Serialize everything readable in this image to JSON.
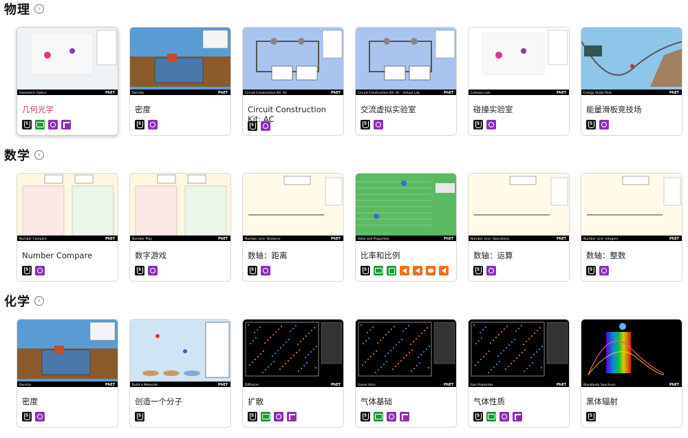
{
  "sections": [
    {
      "title": "物理",
      "cards": [
        {
          "title": "几何光学",
          "active": true,
          "thumb_label": "Geometric Optics",
          "badges": [
            "html5",
            "kbd",
            "zoom",
            "touch"
          ],
          "bg": "#eef3f8"
        },
        {
          "title": "密度",
          "thumb_label": "Density",
          "badges": [
            "html5",
            "zoom"
          ],
          "bg": "#5a9bd4"
        },
        {
          "title": "Circuit Construction Kit: AC",
          "thumb_label": "Circuit Construction Kit: AC",
          "badges": [
            "html5",
            "zoom"
          ],
          "bg": "#a9c4ef"
        },
        {
          "title": "交流虚拟实验室",
          "thumb_label": "Circuit Construction Kit: AC - Virtual Lab",
          "badges": [
            "html5",
            "zoom"
          ],
          "bg": "#a9c4ef"
        },
        {
          "title": "碰撞实验室",
          "thumb_label": "Collision Lab",
          "badges": [
            "html5",
            "zoom"
          ],
          "bg": "#ffffff"
        },
        {
          "title": "能量滑板竞技场",
          "thumb_label": "Energy Skate Park",
          "badges": [
            "html5",
            "zoom"
          ],
          "bg": "#8ec5e8"
        }
      ]
    },
    {
      "title": "数学",
      "cards": [
        {
          "title": "Number Compare",
          "thumb_label": "Number Compare",
          "badges": [
            "html5",
            "zoom"
          ],
          "bg": "#fff6e0"
        },
        {
          "title": "数字游戏",
          "thumb_label": "Number Play",
          "badges": [
            "html5",
            "zoom"
          ],
          "bg": "#fff6e0"
        },
        {
          "title": "数轴：距离",
          "thumb_label": "Number Line: Distance",
          "badges": [
            "html5",
            "zoom"
          ],
          "bg": "#fffbe8"
        },
        {
          "title": "比率和比例",
          "thumb_label": "Ratio and Proportion",
          "badges": [
            "html5",
            "kbd",
            "pan",
            "sound",
            "sound",
            "voice",
            "sound"
          ],
          "bg": "#5cba63"
        },
        {
          "title": "数轴：运算",
          "thumb_label": "Number Line: Operations",
          "badges": [
            "html5",
            "zoom"
          ],
          "bg": "#fffbe8"
        },
        {
          "title": "数轴：整数",
          "thumb_label": "Number Line: Integers",
          "badges": [
            "html5",
            "zoom"
          ],
          "bg": "#fffbe8"
        }
      ]
    },
    {
      "title": "化学",
      "cards": [
        {
          "title": "密度",
          "thumb_label": "Density",
          "badges": [
            "html5",
            "zoom"
          ],
          "bg": "#5a9bd4"
        },
        {
          "title": "创造一个分子",
          "thumb_label": "Build a Molecule",
          "badges": [
            "html5"
          ],
          "bg": "#cfe4f4"
        },
        {
          "title": "扩散",
          "thumb_label": "Diffusion",
          "badges": [
            "html5",
            "kbd",
            "zoom",
            "touch"
          ],
          "bg": "#000000"
        },
        {
          "title": "气体基础",
          "thumb_label": "Gases Intro",
          "badges": [
            "html5",
            "kbd",
            "zoom",
            "touch"
          ],
          "bg": "#000000"
        },
        {
          "title": "气体性质",
          "thumb_label": "Gas Properties",
          "badges": [
            "html5",
            "kbd",
            "zoom",
            "touch"
          ],
          "bg": "#000000"
        },
        {
          "title": "黑体辐射",
          "thumb_label": "Blackbody Spectrum",
          "badges": [
            "html5"
          ],
          "bg": "#000000"
        }
      ]
    }
  ],
  "phet_logo": "PhET",
  "more_glyph": "›",
  "html5_glyph": "5"
}
